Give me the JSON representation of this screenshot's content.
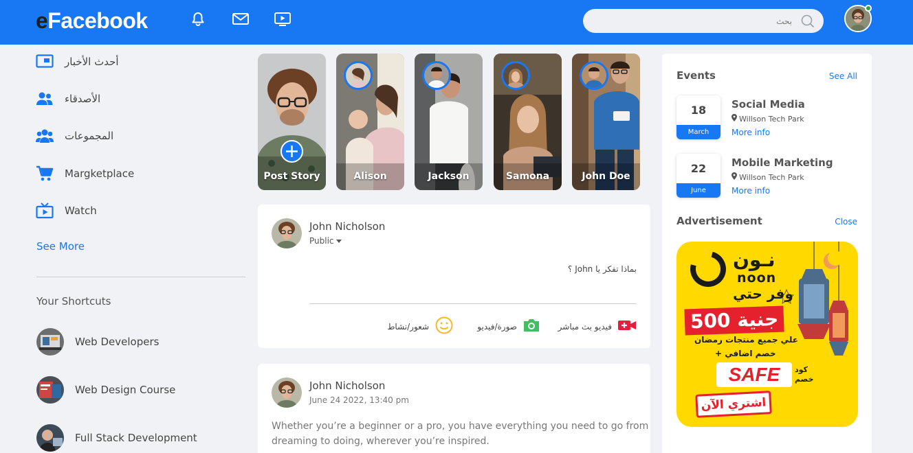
{
  "header": {
    "logo_letter": "e",
    "logo_text": "Facebook",
    "search_placeholder": "بحث"
  },
  "sidebar": {
    "items": [
      {
        "label": "أحدث الأخبار",
        "icon": "news-feed-icon"
      },
      {
        "label": "الأصدقاء",
        "icon": "friends-icon"
      },
      {
        "label": "المجموعات",
        "icon": "groups-icon"
      },
      {
        "label": "Margketplace",
        "icon": "cart-icon"
      },
      {
        "label": "Watch",
        "icon": "watch-icon"
      }
    ],
    "see_more": "See More",
    "shortcuts_title": "Your Shortcuts",
    "shortcuts": [
      {
        "label": "Web Developers"
      },
      {
        "label": "Web Design Course"
      },
      {
        "label": "Full Stack Development"
      }
    ]
  },
  "stories": [
    {
      "name": "Post Story"
    },
    {
      "name": "Alison"
    },
    {
      "name": "Jackson"
    },
    {
      "name": "Samona"
    },
    {
      "name": "John Doe"
    }
  ],
  "composer": {
    "user_name": "John Nicholson",
    "privacy": "Public",
    "prompt": "بماذا تفكر يا John ؟",
    "actions": {
      "live": "فيديو بث مباشر",
      "photo": "صورة/فيديو",
      "feeling": "شعور/نشاط"
    }
  },
  "post": {
    "user_name": "John Nicholson",
    "timestamp": "June 24 2022, 13:40 pm",
    "text_line1": "Whether you’re a beginner or a pro, you have everything you need to go from",
    "text_line2": "dreaming to doing, wherever you’re inspired."
  },
  "events": {
    "title": "Events",
    "see_all": "See All",
    "items": [
      {
        "day": "18",
        "month": "March",
        "title": "Social Media",
        "location": "Willson Tech Park",
        "more": "More info"
      },
      {
        "day": "22",
        "month": "June",
        "title": "Mobile Marketing",
        "location": "Willson Tech Park",
        "more": "More info"
      }
    ]
  },
  "advertisement": {
    "title": "Advertisement",
    "close": "Close",
    "brand_ar": "نـون",
    "brand_en": "noon",
    "tagline": "وفر حتي",
    "amount": "500 جنية",
    "subline": "علي جميع منتجات رمضان",
    "extra": "+ خصم اضافي",
    "code": "SAFE",
    "code_label_1": "كود",
    "code_label_2": "خصم",
    "cta": "اشتري الآن"
  },
  "colors": {
    "brand_blue": "#1877f2",
    "page_bg": "#f0f2f5",
    "ad_yellow": "#ffd900"
  }
}
